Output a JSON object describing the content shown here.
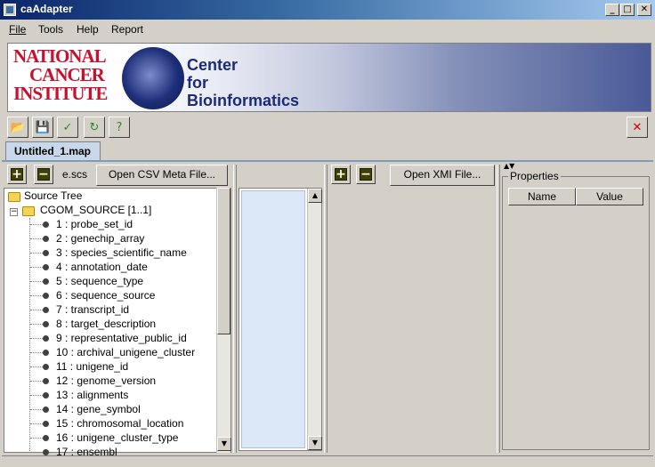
{
  "window": {
    "title": "caAdapter",
    "controls": [
      "_",
      "□",
      "✕"
    ]
  },
  "menu": [
    {
      "label": "File",
      "hotkey": "F"
    },
    {
      "label": "Tools"
    },
    {
      "label": "Help",
      "hotkey": "H"
    },
    {
      "label": "Report",
      "hotkey": "R"
    }
  ],
  "banner": {
    "nci": [
      "NATIONAL",
      "CANCER",
      "INSTITUTE"
    ],
    "center": [
      "Center",
      "for",
      "Bioinformatics"
    ]
  },
  "tab": {
    "label": "Untitled_1.map"
  },
  "source": {
    "file_suffix": "e.scs",
    "open_button": "Open CSV Meta File...",
    "tree_root": "Source Tree",
    "node": "CGOM_SOURCE  [1..1]",
    "items": [
      "1 : probe_set_id",
      "2 : genechip_array",
      "3 : species_scientific_name",
      "4 : annotation_date",
      "5 : sequence_type",
      "6 : sequence_source",
      "7 : transcript_id",
      "8 : target_description",
      "9 : representative_public_id",
      "10 : archival_unigene_cluster",
      "11 : unigene_id",
      "12 : genome_version",
      "13 : alignments",
      "14 : gene_symbol",
      "15 : chromosomal_location",
      "16 : unigene_cluster_type",
      "17 : ensembl"
    ]
  },
  "target": {
    "open_button": "Open XMI File..."
  },
  "properties": {
    "title": "Properties",
    "columns": [
      "Name",
      "Value"
    ]
  },
  "colors": {
    "accent": "#0a246a",
    "tab": "#c8d8ea",
    "panel": "#dce8f8"
  }
}
